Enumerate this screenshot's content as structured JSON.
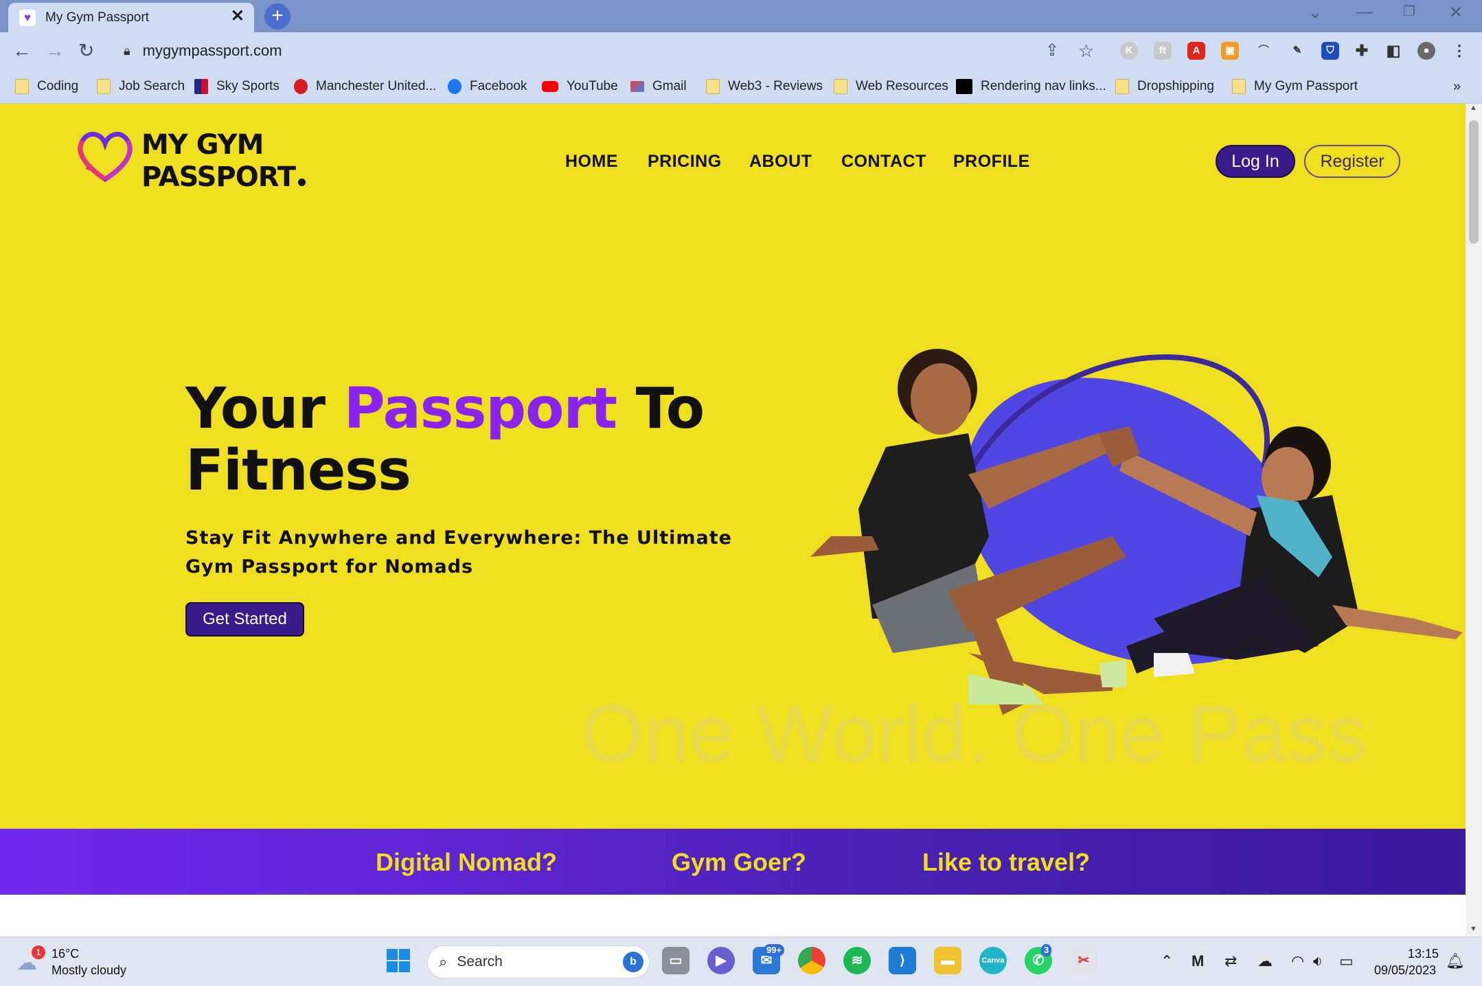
{
  "browser": {
    "tab_title": "My Gym Passport",
    "url": "mygympassport.com",
    "bookmarks": [
      "Coding",
      "Job Search",
      "Sky Sports",
      "Manchester United...",
      "Facebook",
      "YouTube",
      "Gmail",
      "Web3 - Reviews",
      "Web Resources",
      "Rendering nav links...",
      "Dropshipping",
      "My Gym Passport"
    ],
    "more_bookmarks": "»"
  },
  "site": {
    "logo_line1": "MY GYM",
    "logo_line2": "PASSPORT",
    "nav": [
      "HOME",
      "PRICING",
      "ABOUT",
      "CONTACT",
      "PROFILE"
    ],
    "login_label": "Log In",
    "register_label": "Register",
    "hero_title_1": "Your",
    "hero_title_accent": "Passport",
    "hero_title_2": "To",
    "hero_title_3": "Fitness",
    "hero_subtitle": "Stay Fit Anywhere and Everywhere: The Ultimate Gym Passport for Nomads",
    "cta_label": "Get Started",
    "watermark": "One World. One Pass",
    "banner": [
      "Digital Nomad?",
      "Gym Goer?",
      "Like to travel?"
    ],
    "colors": {
      "background": "#efdf1f",
      "accent_purple": "#8a22f0",
      "button": "#3a1b8c",
      "banner_text": "#f0df1e"
    }
  },
  "taskbar": {
    "weather_temp": "16°C",
    "weather_desc": "Mostly cloudy",
    "weather_badge": "1",
    "search_label": "Search",
    "mail_badge": "99+",
    "whatsapp_badge": "3",
    "time": "13:15",
    "date": "09/05/2023"
  }
}
